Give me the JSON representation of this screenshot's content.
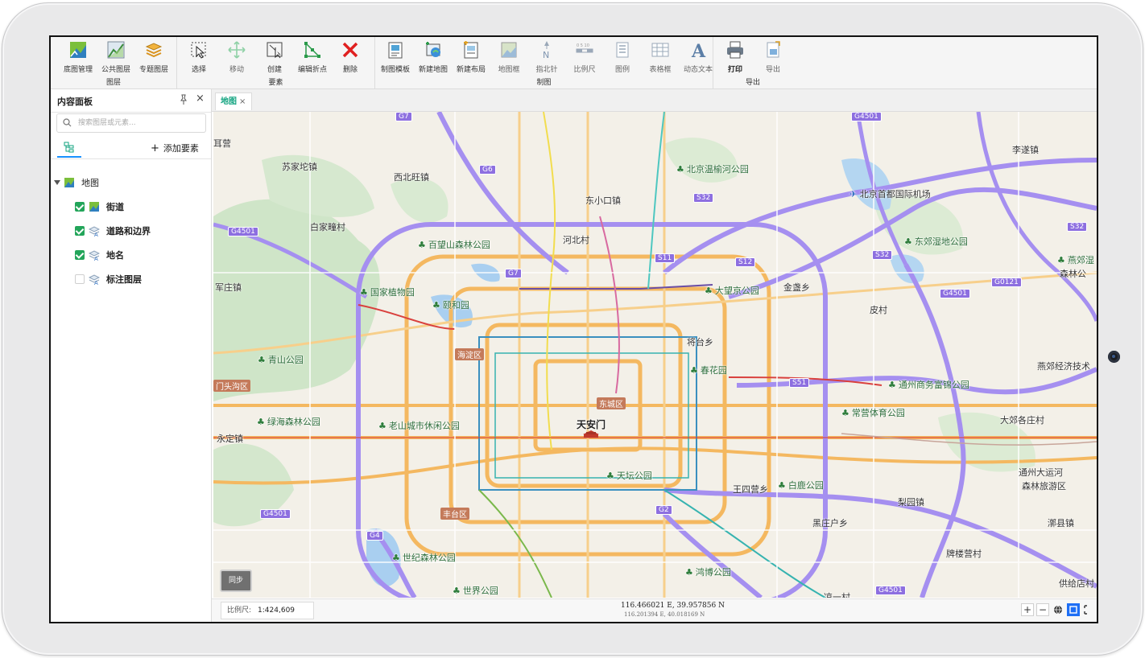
{
  "ribbon": {
    "groups": [
      {
        "label": "图层",
        "tools": [
          {
            "label": "底图管理",
            "icon": "basemap-icon"
          },
          {
            "label": "公共图层",
            "icon": "public-layer-icon"
          },
          {
            "label": "专题图层",
            "icon": "thematic-layer-icon"
          }
        ]
      },
      {
        "label": "要素",
        "tools": [
          {
            "label": "选择",
            "icon": "select-cursor-icon"
          },
          {
            "label": "移动",
            "icon": "move-icon"
          },
          {
            "label": "创建",
            "icon": "create-feature-icon"
          },
          {
            "label": "编辑折点",
            "icon": "edit-vertex-icon"
          },
          {
            "label": "删除",
            "icon": "delete-x-icon"
          }
        ]
      },
      {
        "label": "制图",
        "tools": [
          {
            "label": "制图模板",
            "icon": "template-icon"
          },
          {
            "label": "新建地图",
            "icon": "new-map-icon"
          },
          {
            "label": "新建布局",
            "icon": "new-layout-icon"
          },
          {
            "label": "地图框",
            "icon": "map-frame-icon"
          },
          {
            "label": "指北针",
            "icon": "north-arrow-icon"
          },
          {
            "label": "比例尺",
            "icon": "scale-bar-icon"
          },
          {
            "label": "图例",
            "icon": "legend-icon"
          },
          {
            "label": "表格框",
            "icon": "table-frame-icon"
          },
          {
            "label": "动态文本",
            "icon": "dynamic-text-icon"
          }
        ]
      },
      {
        "label": "导出",
        "tools": [
          {
            "label": "打印",
            "icon": "printer-icon"
          },
          {
            "label": "导出",
            "icon": "export-icon"
          }
        ]
      }
    ]
  },
  "panel": {
    "title": "内容面板",
    "search_placeholder": "搜索图层或元素...",
    "add_label": "添加要素",
    "tree": {
      "root": "地图",
      "layers": [
        {
          "name": "街道",
          "checked": true
        },
        {
          "name": "道路和边界",
          "checked": true
        },
        {
          "name": "地名",
          "checked": true
        },
        {
          "name": "标注图层",
          "checked": false
        }
      ]
    }
  },
  "tabs": [
    {
      "label": "地图",
      "close": "×"
    }
  ],
  "map": {
    "sync_label": "同步",
    "places": [
      "苏家坨镇",
      "西北旺镇",
      "白家疃村",
      "东小口镇",
      "河北村",
      "军庄镇",
      "金盏乡",
      "皮村",
      "将台乡",
      "永定镇",
      "大郊各庄村",
      "梨园镇",
      "黑庄户乡",
      "王四营乡",
      "漷县镇",
      "李遂镇",
      "耳营",
      "天安门",
      "通州大运河",
      "森林旅游区",
      "燕郊经济技术",
      "北京首都国际机场"
    ],
    "parks": [
      "北京温榆河公园",
      "百望山森林公园",
      "国家植物园",
      "颐和园",
      "大望京公园",
      "东郊湿地公园",
      "青山公园",
      "春花园",
      "通州商务富锦公园",
      "绿海森林公园",
      "老山城市休闲公园",
      "常营体育公园",
      "天坛公园",
      "白鹿公园",
      "世纪森林公园",
      "鸿博公园",
      "世界公园",
      "燕郊湿",
      "森林公"
    ],
    "districts": [
      "海淀区",
      "门头沟区",
      "东城区",
      "丰台区"
    ],
    "shields": [
      "G7",
      "G6",
      "G4501",
      "S32",
      "S11",
      "S12",
      "G7",
      "G4501",
      "S51",
      "G0121",
      "G4501",
      "S32",
      "G2",
      "G4",
      "G4501",
      "G4501",
      "S32"
    ],
    "partial_labels": [
      "供给店村",
      "牌楼营村",
      "凉一村"
    ]
  },
  "statusbar": {
    "scale_label": "比例尺:",
    "scale_value": "1:424,609",
    "coord_primary": "116.466021 E, 39.957856 N",
    "coord_secondary": "116.201394 E, 40.018169 N",
    "zoom_in": "+",
    "zoom_out": "−"
  },
  "colors": {
    "accent": "#10a37f",
    "checkbox": "#23a55a",
    "expressway": "#8d6fe0",
    "arterial": "#f4b860",
    "district_badge": "#c47a5a",
    "active_button": "#1e6ff5"
  }
}
